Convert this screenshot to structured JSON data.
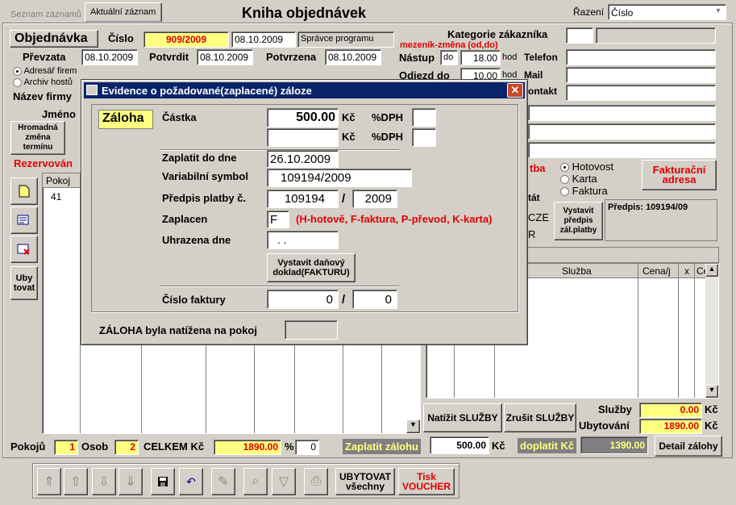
{
  "tabs": [
    "Seznam záznamů",
    "Aktuální záznam"
  ],
  "header": {
    "title": "Kniha objednávek",
    "sort_label": "Řazení",
    "sort_value": "Číslo"
  },
  "order": {
    "section": "Objednávka",
    "number_label": "Číslo",
    "number": "909/2009",
    "date": "08.10.2009",
    "admin": "Správce programu",
    "taken_label": "Převzata",
    "taken": "08.10.2009",
    "confirm_label": "Potvrdit",
    "confirm": "08.10.2009",
    "confirmed_label": "Potvrzena",
    "confirmed": "08.10.2009",
    "radio1": "Adresář firem",
    "radio2": "Archiv hostů",
    "company_label": "Název firmy",
    "name_label": "Jméno",
    "change_term": "Hromadná změna termínu",
    "reserved": "Rezervován"
  },
  "right": {
    "category_label": "Kategorie zákazníka",
    "interval_note": "mezeník-změna (od,do)",
    "arrival_label": "Nástup",
    "arrival_prefix": "do",
    "arrival_time": "18.00",
    "arrival_unit": "hod",
    "phone_label": "Telefon",
    "departure_label": "Odjezd do",
    "departure_time": "10.00",
    "departure_unit": "hod",
    "mail_label": "Mail",
    "contact_label": "ontakt",
    "pay_cash": "Hotovost",
    "pay_card": "Karta",
    "pay_invoice": "Faktura",
    "billing": "Fakturační adresa",
    "state_label": "tát",
    "country": "CZE",
    "pay_label": "tba",
    "r_letter": "R",
    "issue_prepay": "Vystavit předpis zál.platby",
    "prescript": "Předpis: 109194/09"
  },
  "grid_left": {
    "col": "Pokoj",
    "row": "41"
  },
  "left_tools": {
    "uby": "Uby tovat"
  },
  "services": {
    "col_service": "Služba",
    "col_price": "Cena/j",
    "col_x": "x",
    "col_ce": "Ce",
    "apply": "Natížit SLUŽBY",
    "cancel": "Zrušit SLUŽBY",
    "svc_label": "Služby",
    "svc_value": "0.00",
    "acc_label": "Ubytování",
    "acc_value": "1890.00",
    "cur": "Kč"
  },
  "totals": {
    "rooms_label": "Pokojů",
    "rooms": "1",
    "people_label": "Osob",
    "people": "2",
    "total_label": "CELKEM Kč",
    "total": "1890.00",
    "pct": "%",
    "discount": "0",
    "pay_deposit": "Zaplatit zálohu",
    "deposit": "500.00",
    "cur": "Kč",
    "remaining_label": "doplatit Kč",
    "remaining": "1390.00",
    "detail": "Detail zálohy"
  },
  "toolbar": {
    "accommodate_all": "UBYTOVAT všechny",
    "print_voucher": "Tisk VOUCHER"
  },
  "dialog": {
    "title": "Evidence o požadované(zaplacené) záloze",
    "heading": "Záloha",
    "amount_label": "Částka",
    "amount": "500.00",
    "cur": "Kč",
    "vat_label": "%DPH",
    "pay_by_label": "Zaplatit do dne",
    "pay_by": "26.10.2009",
    "var_symbol_label": "Variabilní symbol",
    "var_symbol": "109194/2009",
    "prescript_label": "Předpis platby č.",
    "prescript_no": "109194",
    "slash": "/",
    "prescript_year": "2009",
    "paid_label": "Zaplacen",
    "paid_code": "F",
    "paid_hint": "(H-hotově, F-faktura, P-převod, K-karta)",
    "settled_label": "Uhrazena dne",
    "settled": ". .",
    "issue_doc": "Vystavit daňový doklad(FAKTURU)",
    "invoice_label": "Číslo faktury",
    "invoice_no": "0",
    "invoice_year": "0",
    "room_note": "ZÁLOHA byla natížena na pokoj"
  }
}
